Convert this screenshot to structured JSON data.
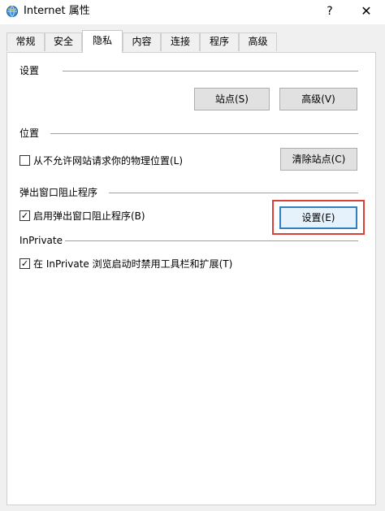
{
  "window": {
    "title": "Internet 属性",
    "help_glyph": "?",
    "close_glyph": "✕"
  },
  "tabs": [
    {
      "label": "常规"
    },
    {
      "label": "安全"
    },
    {
      "label": "隐私",
      "selected": true
    },
    {
      "label": "内容"
    },
    {
      "label": "连接"
    },
    {
      "label": "程序"
    },
    {
      "label": "高级"
    }
  ],
  "settings": {
    "label": "设置",
    "sites_button": "站点(S)",
    "advanced_button": "高级(V)"
  },
  "location": {
    "label": "位置",
    "checkbox_label": "从不允许网站请求你的物理位置(L)",
    "checkbox_checked": false,
    "clear_button": "清除站点(C)"
  },
  "popup_blocker": {
    "label": "弹出窗口阻止程序",
    "checkbox_label": "启用弹出窗口阻止程序(B)",
    "checkbox_checked": true,
    "settings_button": "设置(E)"
  },
  "inprivate": {
    "label": "InPrivate",
    "checkbox_label": "在 InPrivate 浏览启动时禁用工具栏和扩展(T)",
    "checkbox_checked": true
  },
  "check_glyph": "✓",
  "colors": {
    "highlight": "#d9403a",
    "focus_border": "#2f7fc1"
  }
}
